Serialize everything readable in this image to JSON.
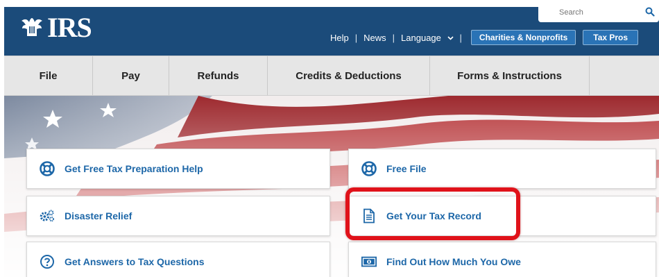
{
  "header": {
    "logo_text": "IRS",
    "search_placeholder": "Search",
    "links": [
      "Help",
      "News",
      "Language"
    ],
    "buttons": [
      "Charities & Nonprofits",
      "Tax Pros"
    ],
    "brand_color": "#1b4b7a"
  },
  "nav": {
    "items": [
      "File",
      "Pay",
      "Refunds",
      "Credits & Deductions",
      "Forms & Instructions"
    ]
  },
  "cards": [
    {
      "label": "Get Free Tax Preparation Help",
      "icon": "lifebuoy-icon"
    },
    {
      "label": "Free File",
      "icon": "lifebuoy-icon"
    },
    {
      "label": "Disaster Relief",
      "icon": "gears-icon"
    },
    {
      "label": "Get Your Tax Record",
      "icon": "document-icon"
    },
    {
      "label": "Get Answers to Tax Questions",
      "icon": "question-circle-icon"
    },
    {
      "label": "Find Out How Much You Owe",
      "icon": "money-bill-icon"
    }
  ],
  "highlight_color": "#e0121a",
  "link_color": "#1d67a8"
}
